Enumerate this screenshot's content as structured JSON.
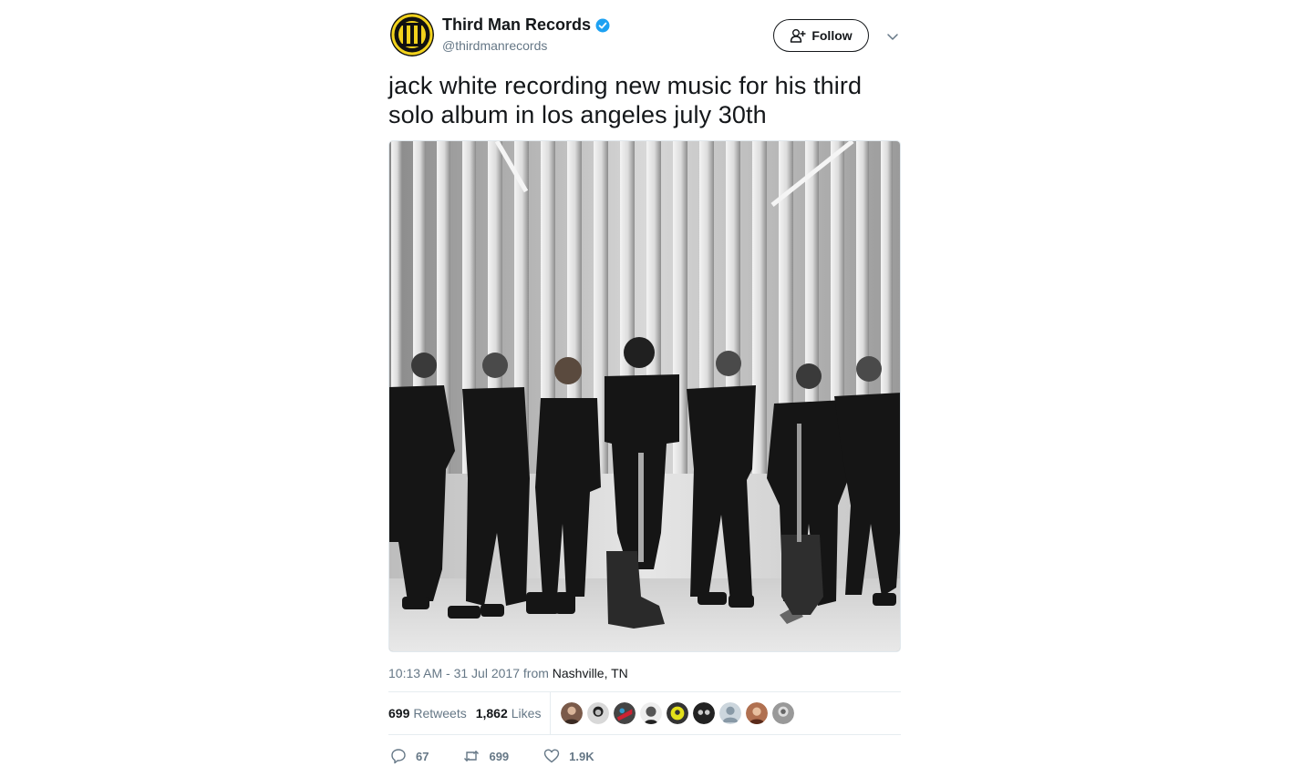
{
  "tweet": {
    "display_name": "Third Man Records",
    "handle": "@thirdmanrecords",
    "verified": true,
    "follow_label": "Follow",
    "text_line1": "jack white recording new music for his third",
    "text_line2": "solo album in los angeles july 30th",
    "timestamp": "10:13 AM - 31 Jul 2017",
    "from_label": "from",
    "location": "Nashville, TN",
    "retweets_count": "699",
    "retweets_label": "Retweets",
    "likes_count": "1,862",
    "likes_label": "Likes",
    "liker_avatars": [
      "avatar-1",
      "avatar-2",
      "avatar-3",
      "avatar-4",
      "avatar-5",
      "avatar-6",
      "avatar-7",
      "avatar-8",
      "avatar-9"
    ],
    "actions": {
      "reply_count": "67",
      "retweet_count": "699",
      "like_count": "1.9K"
    }
  },
  "colors": {
    "text": "#14171a",
    "secondary": "#657786",
    "verified": "#1da1f2",
    "border": "#e6ecf0",
    "avatar_yellow": "#f2d21c"
  },
  "icons": {
    "verified": "verified-badge-icon",
    "follow": "add-person-icon",
    "caret": "chevron-down-icon",
    "reply": "reply-icon",
    "retweet": "retweet-icon",
    "like": "heart-icon"
  }
}
